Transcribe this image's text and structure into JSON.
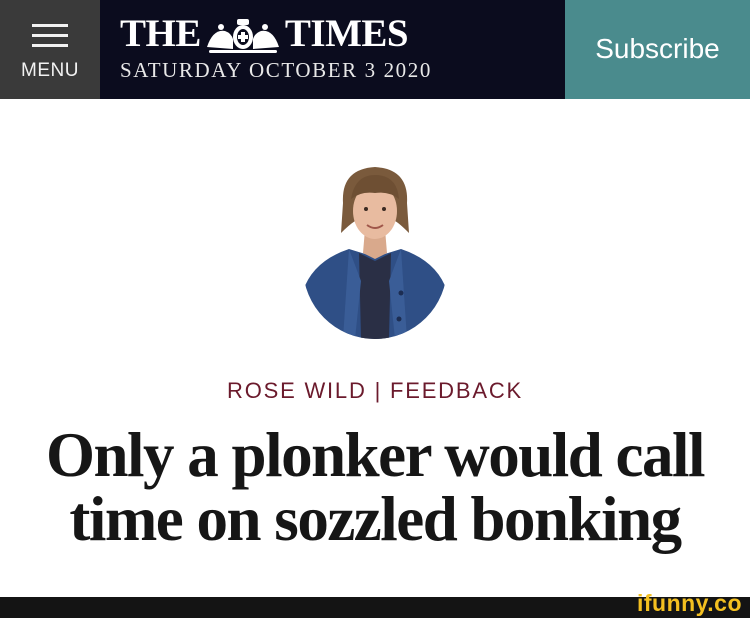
{
  "header": {
    "menu_label": "MENU",
    "logo_left": "THE",
    "logo_right": "TIMES",
    "date": "SATURDAY OCTOBER 3 2020",
    "subscribe_label": "Subscribe"
  },
  "article": {
    "byline": "ROSE WILD | FEEDBACK",
    "headline": "Only a plonker would call time on sozzled bonking"
  },
  "watermark": "ifunny.co",
  "colors": {
    "menu_bg": "#3a3a3a",
    "masthead_bg": "#0b0c1e",
    "subscribe_bg": "#4a8b8d",
    "byline": "#6b1a2c",
    "headline": "#161616"
  },
  "icons": [
    "hamburger-icon",
    "crest-icon",
    "author-avatar"
  ]
}
